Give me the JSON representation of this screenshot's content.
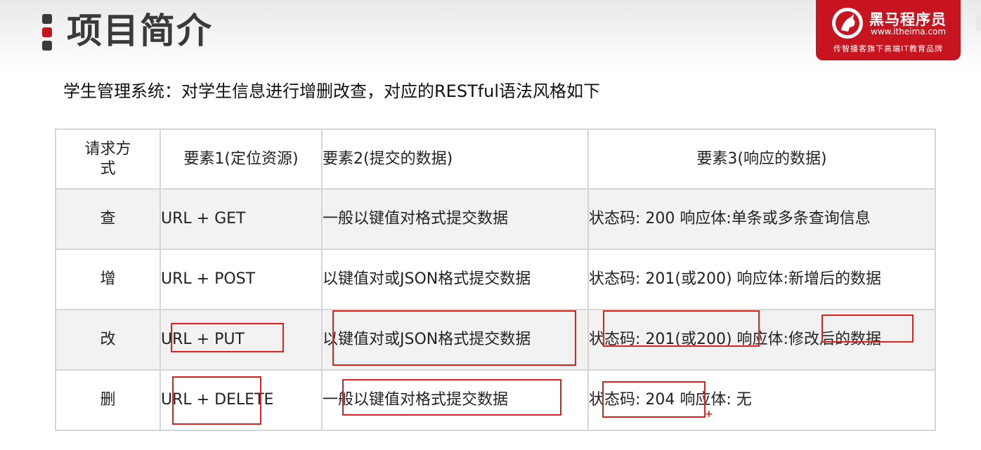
{
  "header": {
    "title": "项目简介"
  },
  "logo": {
    "name": "黑马程序员",
    "url": "www.itheima.com",
    "tagline": "传智播客旗下高端IT教育品牌"
  },
  "intro": "学生管理系统：对学生信息进行增删改查，对应的RESTful语法风格如下",
  "table": {
    "headers": [
      "请求方式",
      "要素1(定位资源)",
      "要素2(提交的数据)",
      "要素3(响应的数据)"
    ],
    "rows": [
      [
        "查",
        "URL + GET",
        "一般以键值对格式提交数据",
        "状态码: 200 响应体:单条或多条查询信息"
      ],
      [
        "增",
        "URL + POST",
        "以键值对或JSON格式提交数据",
        "状态码: 201(或200) 响应体:新增后的数据"
      ],
      [
        "改",
        "URL + PUT",
        "以键值对或JSON格式提交数据",
        "状态码: 201(或200) 响应体:修改后的数据"
      ],
      [
        "删",
        "URL + DELETE",
        "一般以键值对格式提交数据",
        "状态码: 204 响应体: 无"
      ]
    ]
  },
  "annotation": {
    "mark": "+"
  },
  "colors": {
    "brand": "#c8141e",
    "annotation": "#e0201e",
    "title": "#3a3a3a"
  }
}
